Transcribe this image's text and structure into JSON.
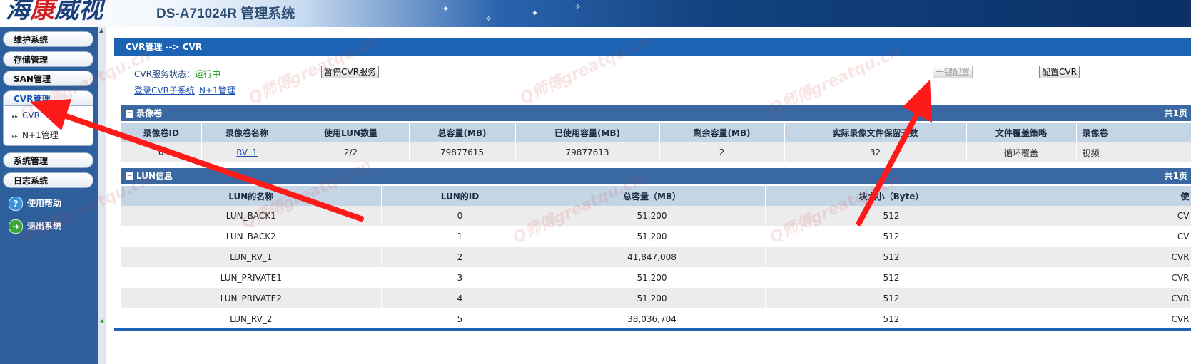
{
  "header": {
    "logo_part1": "海",
    "logo_part2": "康",
    "logo_part3": "威视",
    "title": "DS-A71024R 管理系统"
  },
  "sidebar": {
    "menu": [
      {
        "label": "维护系统"
      },
      {
        "label": "存储管理"
      },
      {
        "label": "SAN管理"
      },
      {
        "label": "CVR管理"
      }
    ],
    "submenu": [
      {
        "label": "CVR"
      },
      {
        "label": "N+1管理"
      }
    ],
    "menu2": [
      {
        "label": "系统管理"
      },
      {
        "label": "日志系统"
      }
    ],
    "help_label": "使用帮助",
    "exit_label": "退出系统"
  },
  "breadcrumb": "CVR管理 --> CVR",
  "cvr": {
    "status_label": "CVR服务状态：",
    "status_value": "运行中",
    "pause_button": "暂停CVR服务",
    "oneclick_button": "一键配置",
    "config_button": "配置CVR",
    "login_link": "登录CVR子系统",
    "n1_link": "N+1管理"
  },
  "record_volumes": {
    "title": "录像卷",
    "pages": "共1页",
    "columns": [
      "录像卷ID",
      "录像卷名称",
      "使用LUN数量",
      "总容量(MB)",
      "已使用容量(MB)",
      "剩余容量(MB)",
      "实际录像文件保留天数",
      "文件覆盖策略",
      "录像卷"
    ],
    "rows": [
      [
        "0",
        "RV_1",
        "2/2",
        "79877615",
        "79877613",
        "2",
        "32",
        "循环覆盖",
        "视频"
      ]
    ]
  },
  "lun_info": {
    "title": "LUN信息",
    "pages": "共1页",
    "columns": [
      "LUN的名称",
      "LUN的ID",
      "总容量（MB）",
      "块大小（Byte）",
      "使"
    ],
    "rows": [
      [
        "LUN_BACK1",
        "0",
        "51,200",
        "512",
        "CV"
      ],
      [
        "LUN_BACK2",
        "1",
        "51,200",
        "512",
        "CV"
      ],
      [
        "LUN_RV_1",
        "2",
        "41,847,008",
        "512",
        "CVR"
      ],
      [
        "LUN_PRIVATE1",
        "3",
        "51,200",
        "512",
        "CVR"
      ],
      [
        "LUN_PRIVATE2",
        "4",
        "51,200",
        "512",
        "CVR"
      ],
      [
        "LUN_RV_2",
        "5",
        "38,036,704",
        "512",
        "CVR"
      ]
    ]
  },
  "watermark": "Q师傅greatqu.cn",
  "colors": {
    "accent": "#1d63b3",
    "sidebar": "#2d5f9d",
    "arrow": "#ff1a1a",
    "status_ok": "#1a9a1a"
  },
  "icons": {
    "help": "question-circle-icon",
    "exit": "arrow-right-circle-icon"
  }
}
